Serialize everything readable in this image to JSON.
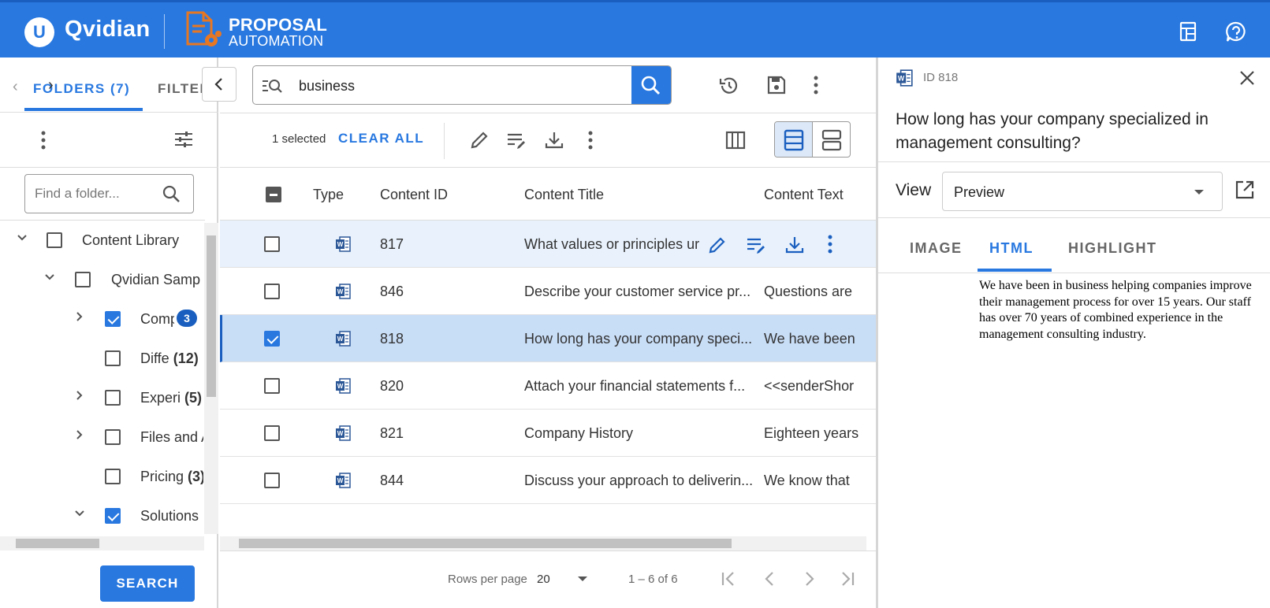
{
  "header": {
    "brand": "Qvidian",
    "logo_letter": "U",
    "product_line1": "PROPOSAL",
    "product_line2": "AUTOMATION",
    "icons": [
      "calculator-icon",
      "help-icon"
    ]
  },
  "left": {
    "tab_folders": "FOLDERS (7)",
    "tab_filter": "FILTERS",
    "folder_search_placeholder": "Find a folder...",
    "tree": [
      {
        "label": "Content Library",
        "count": "",
        "checked": "none"
      },
      {
        "label": "Qvidian Sample Content",
        "count": "",
        "checked": "none"
      },
      {
        "label": "Company",
        "count": "",
        "badge": "3",
        "checked": "on"
      },
      {
        "label": "Diffe",
        "count": "(12)",
        "checked": "none"
      },
      {
        "label": "Experi",
        "count": "(5)",
        "checked": "none"
      },
      {
        "label": "Files and Attachments",
        "count": "",
        "checked": "none"
      },
      {
        "label": "Pricing",
        "count": "(3)",
        "checked": "none"
      },
      {
        "label": "Solutions",
        "count": "",
        "checked": "on"
      }
    ],
    "search_button": "SEARCH"
  },
  "center": {
    "search_value": "business",
    "selected_text": "1 selected",
    "clear_all": "CLEAR ALL",
    "columns": [
      "Type",
      "Content ID",
      "Content Title",
      "Content Text"
    ],
    "rows": [
      {
        "id": "817",
        "title": "What values or principles ur",
        "text": "",
        "checked": false,
        "state": "hover"
      },
      {
        "id": "846",
        "title": "Describe your customer service pr...",
        "text": "Questions are",
        "checked": false,
        "state": ""
      },
      {
        "id": "818",
        "title": "How long has your company speci...",
        "text": "We have been",
        "checked": true,
        "state": "sel"
      },
      {
        "id": "820",
        "title": "Attach your financial statements f...",
        "text": "<<senderShor",
        "checked": false,
        "state": ""
      },
      {
        "id": "821",
        "title": "Company History",
        "text": "Eighteen years",
        "checked": false,
        "state": ""
      },
      {
        "id": "844",
        "title": "Discuss your approach to deliverin...",
        "text": "We know that",
        "checked": false,
        "state": ""
      }
    ],
    "pager": {
      "rows_per_page_label": "Rows per page",
      "rows_per_page": "20",
      "range": "1 – 6 of 6"
    }
  },
  "right": {
    "id_label": "ID 818",
    "title": "How long has your company specialized in management consulting?",
    "view_label": "View",
    "view_value": "Preview",
    "tabs": [
      "IMAGE",
      "HTML",
      "HIGHLIGHT"
    ],
    "active_tab": "HTML",
    "content": "We have been in business helping companies improve their management process for over 15 years.  Our staff has over 70 years of combined experience in the management consulting industry."
  },
  "colors": {
    "brand_blue": "#2878e0",
    "selected_row": "#c8ddf6",
    "hover_row": "#e8f1fc",
    "badge": "#1a5fbf",
    "pa_orange": "#e87722"
  }
}
